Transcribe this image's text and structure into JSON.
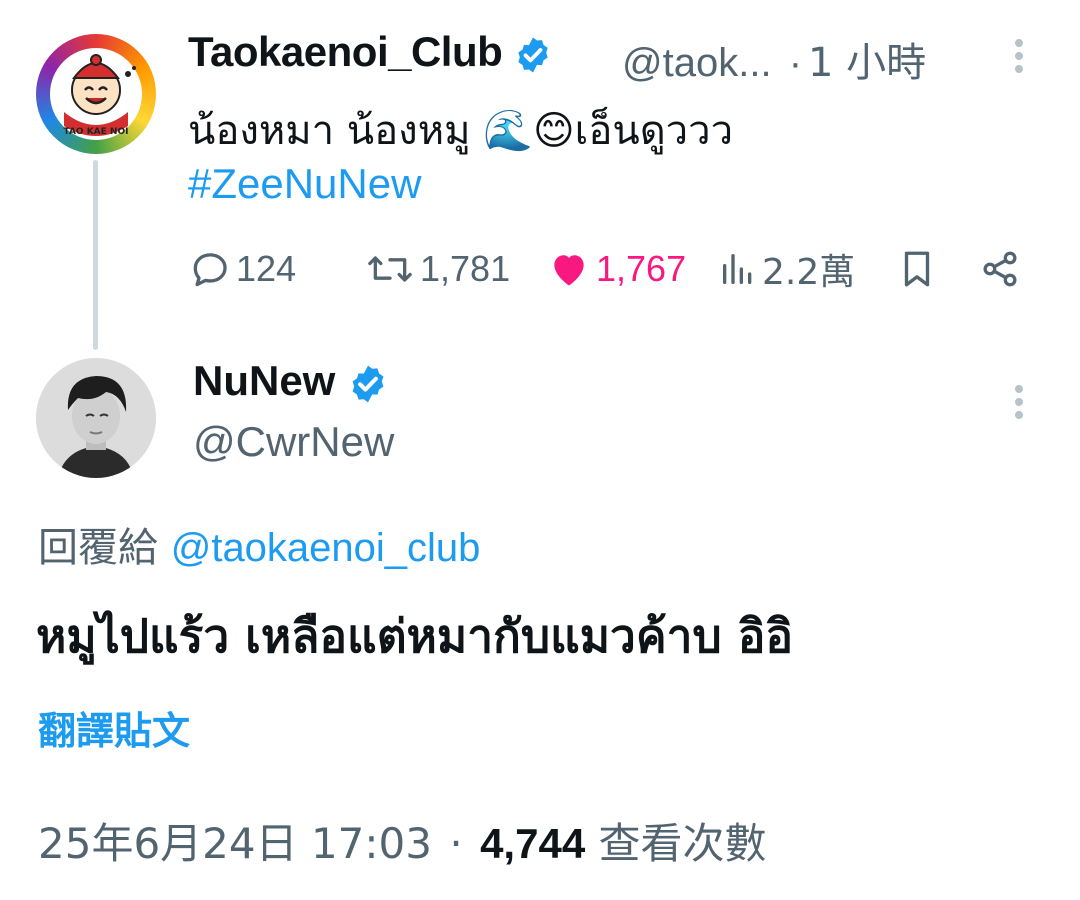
{
  "parent_post": {
    "display_name": "Taokaenoi_Club",
    "handle": "@taok...",
    "time": "1 小時",
    "text": "น้องหมา น้องหมู 🌊😊เอ็นดูววว",
    "hashtag": "#ZeeNuNew",
    "avatar_label": "TAO KAE NOI",
    "actions": {
      "replies": "124",
      "reposts": "1,781",
      "likes": "1,767",
      "views": "2.2萬"
    }
  },
  "reply_post": {
    "display_name": "NuNew",
    "handle": "@CwrNew",
    "reply_prefix": "回覆給",
    "reply_to": "@taokaenoi_club",
    "text": "หมูไปแร้ว เหลือแต่หมากับแมวค้าบ อิอิ",
    "translate_label": "翻譯貼文",
    "timestamp": "25年6月24日 17:03",
    "separator": "·",
    "view_count": "4,744",
    "view_label": "查看次數"
  },
  "colors": {
    "accent": "#1d9bf0",
    "like": "#f91880",
    "secondary_text": "#536471",
    "primary_text": "#0f1419"
  },
  "icons": [
    "verified-badge-icon",
    "more-options-icon",
    "reply-icon",
    "repost-icon",
    "like-icon",
    "views-icon",
    "bookmark-icon",
    "share-icon"
  ]
}
